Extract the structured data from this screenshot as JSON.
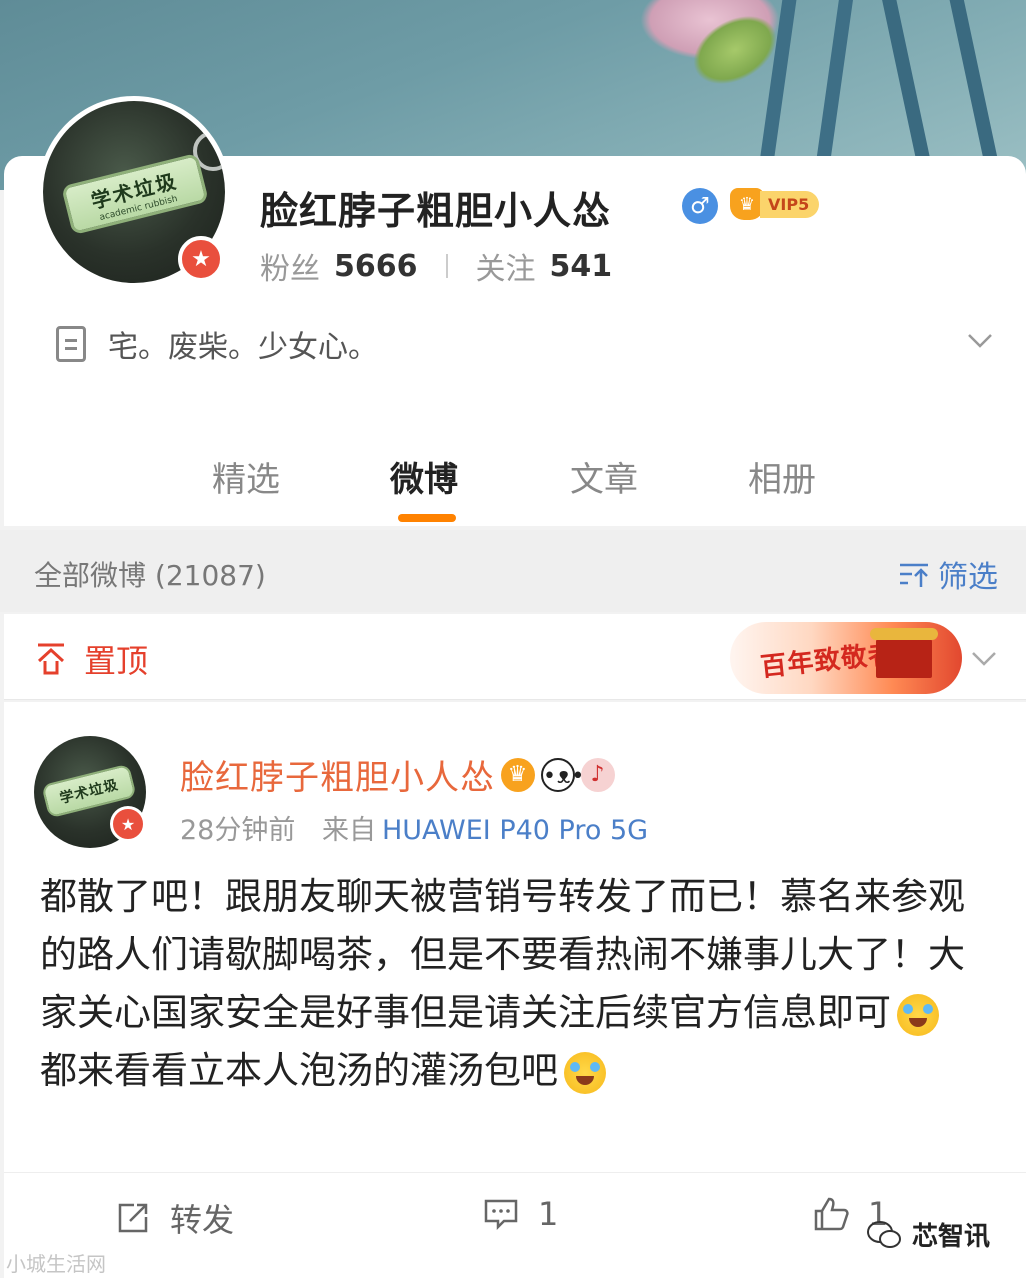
{
  "profile": {
    "name": "脸红脖子粗胆小人怂",
    "vip_label": "VIP5",
    "followers_label": "粉丝",
    "followers_count": "5666",
    "following_label": "关注",
    "following_count": "541",
    "bio": "宅。废柴。少女心。",
    "avatar_keychain_text": "学术垃圾",
    "avatar_keychain_sub": "academic rubbish"
  },
  "tabs": [
    {
      "label": "精选",
      "active": false
    },
    {
      "label": "微博",
      "active": true
    },
    {
      "label": "文章",
      "active": false
    },
    {
      "label": "相册",
      "active": false
    }
  ],
  "feed": {
    "count_label": "全部微博 (21087)",
    "filter_label": "筛选"
  },
  "pinned": {
    "label": "置顶",
    "promo_text": "百年致敬者"
  },
  "post": {
    "author": "脸红脖子粗胆小人怂",
    "time": "28分钟前",
    "source_prefix": "来自",
    "source": "HUAWEI P40 Pro 5G",
    "line1": "都散了吧！跟朋友聊天被营销号转发了而已！慕名来参观的路人们请歇脚喝茶，但是不要看热闹不嫌事儿大了！大家关心国家安全是好事但是请关注后续官方信息即可",
    "line2": "都来看看立本人泡汤的灌汤包吧",
    "repost_label": "转发",
    "comment_count": "1",
    "like_count": "1"
  },
  "watermarks": {
    "left": "小城生活网",
    "right": "芯智讯"
  },
  "colors": {
    "accent": "#ff8200",
    "link": "#4b7fc8",
    "pin": "#e5402c",
    "author": "#e8683c"
  }
}
